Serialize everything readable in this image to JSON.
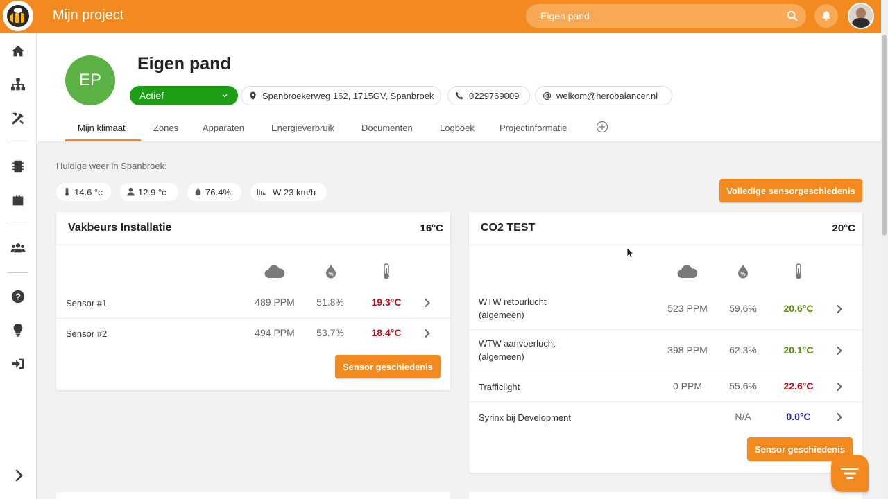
{
  "app": {
    "title": "Mijn project"
  },
  "search": {
    "value": "",
    "placeholder": "Eigen pand"
  },
  "header": {
    "initials": "EP",
    "name": "Eigen pand",
    "status": "Actief",
    "address": "Spanbroekerweg 162, 1715GV, Spanbroek",
    "phone": "0229769009",
    "email": "welkom@herobalancer.nl"
  },
  "tabs": [
    {
      "label": "Mijn klimaat"
    },
    {
      "label": "Zones"
    },
    {
      "label": "Apparaten"
    },
    {
      "label": "Energieverbruik"
    },
    {
      "label": "Documenten"
    },
    {
      "label": "Logboek"
    },
    {
      "label": "Projectinformatie"
    }
  ],
  "weather": {
    "label": "Huidige weer in Spanbroek:",
    "temperature": "14.6 °c",
    "feels_like": "12.9 °c",
    "humidity": "76.4%",
    "wind": "W 23 km/h"
  },
  "full_history_button": "Volledige sensorgeschiedenis",
  "sensor_history_button": "Sensor geschiedenis",
  "zones": [
    {
      "title": "Vakbeurs Installatie",
      "temp": "16°C",
      "sensors": [
        {
          "name": "Sensor #1",
          "co2": "489 PPM",
          "humidity": "51.8%",
          "temp": "19.3°C",
          "temp_color": "#b5121b"
        },
        {
          "name": "Sensor #2",
          "co2": "494 PPM",
          "humidity": "53.7%",
          "temp": "18.4°C",
          "temp_color": "#b5121b"
        }
      ]
    },
    {
      "title": "CO2 TEST",
      "temp": "20°C",
      "sensors": [
        {
          "name": "WTW retourlucht (algemeen)",
          "co2": "523 PPM",
          "humidity": "59.6%",
          "temp": "20.6°C",
          "temp_color": "#5a8a0f"
        },
        {
          "name": "WTW aanvoerlucht (algemeen)",
          "co2": "398 PPM",
          "humidity": "62.3%",
          "temp": "20.1°C",
          "temp_color": "#5a8a0f"
        },
        {
          "name": "Trafficlight",
          "co2": "0 PPM",
          "humidity": "55.6%",
          "temp": "22.6°C",
          "temp_color": "#b5121b"
        },
        {
          "name": "Syrinx bij Development",
          "co2": "",
          "humidity": "N/A",
          "temp": "0.0°C",
          "temp_color": "#1a1aa8"
        }
      ]
    }
  ],
  "colors": {
    "brand": "#f28a1f",
    "status_active": "#1e9e17",
    "avatar": "#5bb144"
  }
}
